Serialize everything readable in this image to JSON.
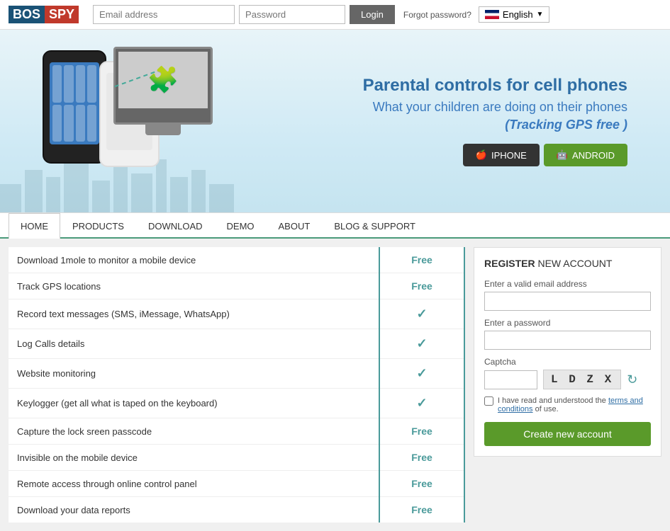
{
  "header": {
    "logo_bos": "BOS",
    "logo_spy": "SPY",
    "email_placeholder": "Email address",
    "password_placeholder": "Password",
    "login_label": "Login",
    "forgot_password": "Forgot password?",
    "language": "English"
  },
  "hero": {
    "title": "Parental controls for cell phones",
    "subtitle": "What your children are doing on their phones",
    "tracking": "(Tracking GPS",
    "tracking_free": "free",
    "tracking_end": ")",
    "iphone_label": "IPHONE",
    "android_label": "ANDROID"
  },
  "nav": {
    "items": [
      {
        "label": "HOME",
        "active": true
      },
      {
        "label": "PRODUCTS",
        "active": false
      },
      {
        "label": "DOWNLOAD",
        "active": false
      },
      {
        "label": "DEMO",
        "active": false
      },
      {
        "label": "ABOUT",
        "active": false
      },
      {
        "label": "BLOG & SUPPORT",
        "active": false
      }
    ]
  },
  "features": {
    "rows": [
      {
        "feature": "Download 1mole to monitor a mobile device",
        "value": "Free",
        "type": "free"
      },
      {
        "feature": "Track GPS locations",
        "value": "Free",
        "type": "free"
      },
      {
        "feature": "Record text messages (SMS, iMessage, WhatsApp)",
        "value": "✓",
        "type": "check"
      },
      {
        "feature": "Log Calls details",
        "value": "✓",
        "type": "check"
      },
      {
        "feature": "Website monitoring",
        "value": "✓",
        "type": "check"
      },
      {
        "feature": "Keylogger (get all what is taped on the keyboard)",
        "value": "✓",
        "type": "check"
      },
      {
        "feature": "Capture the lock sreen passcode",
        "value": "Free",
        "type": "free"
      },
      {
        "feature": "Invisible on the mobile device",
        "value": "Free",
        "type": "free"
      },
      {
        "feature": "Remote access through online control panel",
        "value": "Free",
        "type": "free"
      },
      {
        "feature": "Download your data reports",
        "value": "Free",
        "type": "free"
      }
    ]
  },
  "register": {
    "title_bold": "REGISTER",
    "title_rest": " NEW ACCOUNT",
    "email_label": "Enter a valid email address",
    "password_label": "Enter a password",
    "captcha_label": "Captcha",
    "captcha_text": "L D Z X",
    "terms_text": "I have read and understood the",
    "terms_link": "terms and conditions",
    "terms_end": "of use.",
    "create_button": "Create new account"
  }
}
